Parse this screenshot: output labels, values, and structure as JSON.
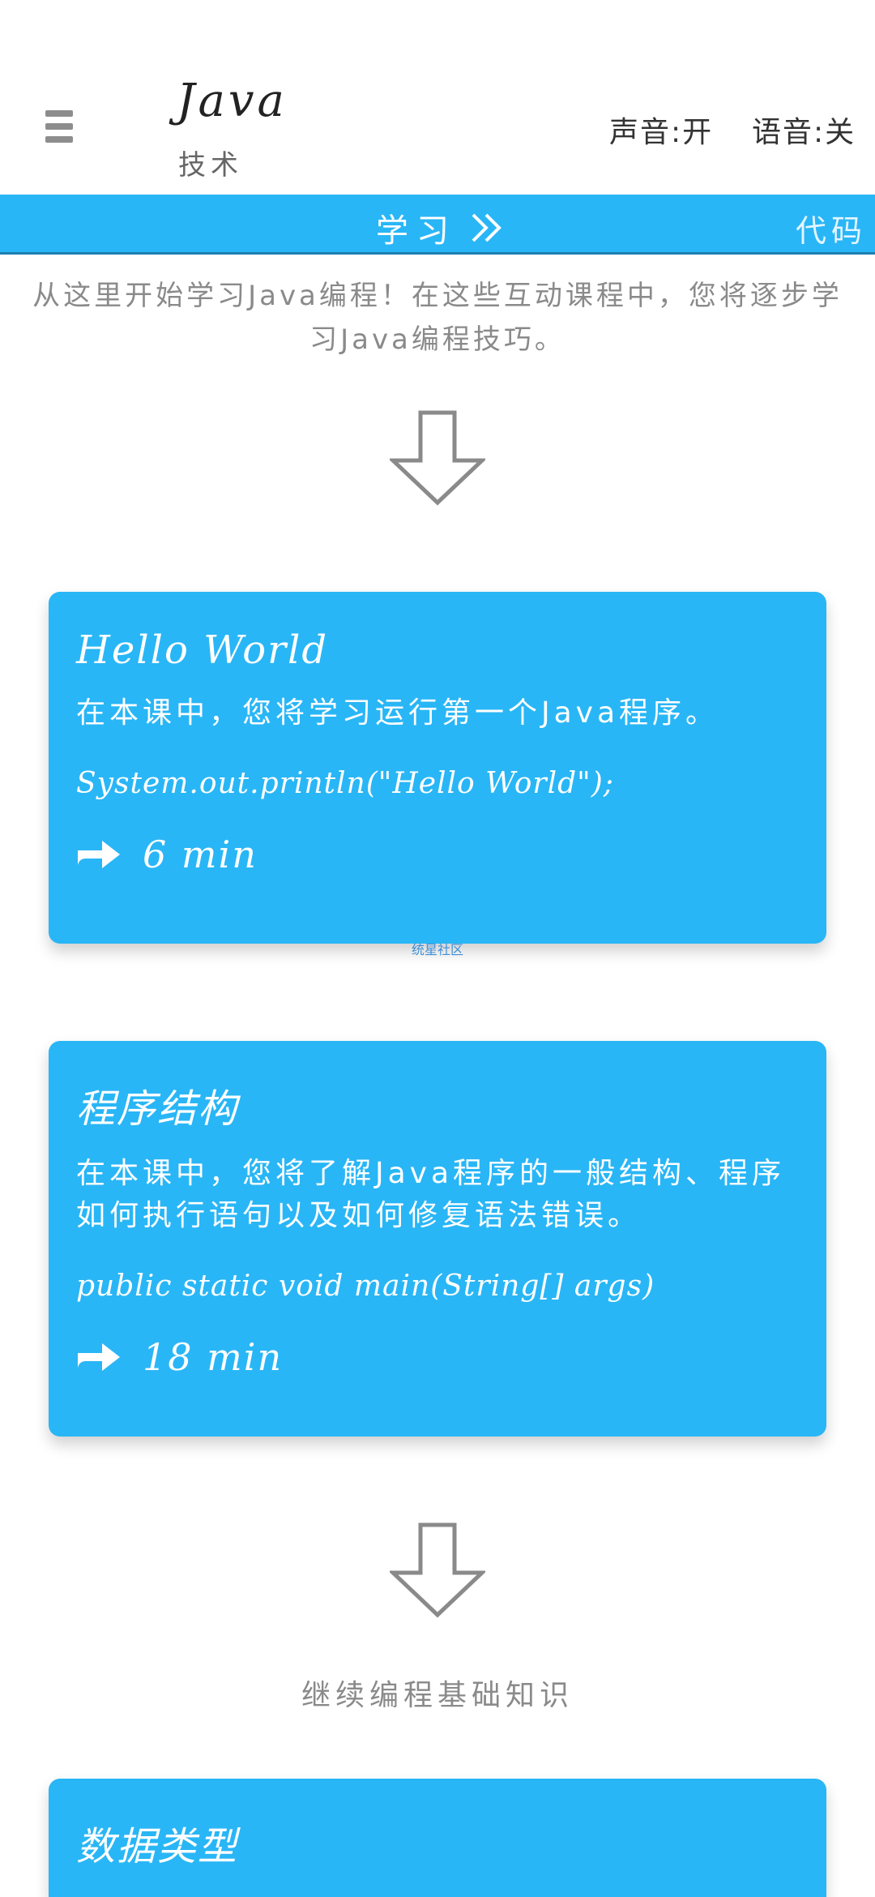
{
  "header": {
    "title": "Java",
    "subtitle": "技术",
    "sound": "声音:开",
    "voice": "语音:关"
  },
  "tabs": {
    "learn": "学习",
    "code": "代码"
  },
  "intro_text": "从这里开始学习Java编程！在这些互动课程中，您将逐步学习Java编程技巧。",
  "watermark": "统星社区",
  "lessons": [
    {
      "title": "Hello World",
      "description": "在本课中，您将学习运行第一个Java程序。",
      "code": "System.out.println(\"Hello World\");",
      "duration": "6 min"
    },
    {
      "title": "程序结构",
      "description": "在本课中，您将了解Java程序的一般结构、程序如何执行语句以及如何修复语法错误。",
      "code": "public static void main(String[] args)",
      "duration": "18 min"
    },
    {
      "title": "数据类型"
    }
  ],
  "section_heading": "继续编程基础知识",
  "colors": {
    "accent": "#29b6f6",
    "muted_text": "#8a8a8a",
    "arrow_stroke": "#8a8a8a"
  }
}
